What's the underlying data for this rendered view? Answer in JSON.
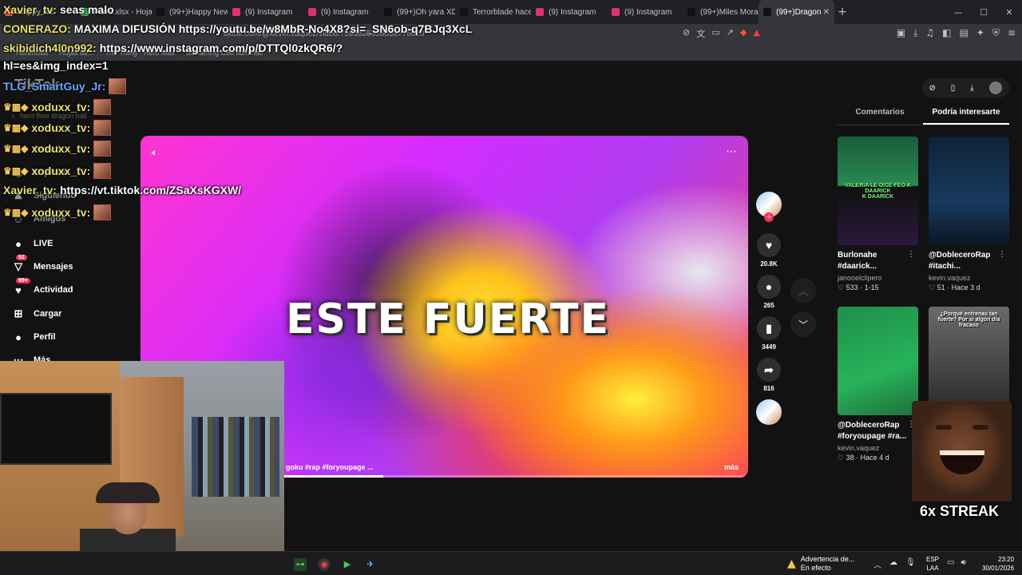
{
  "browser": {
    "tabs": [
      {
        "label": "Happy Ric",
        "color": "#ff4b4b"
      },
      {
        "label": "Perre.xlsx - Hojas",
        "color": "#34a853"
      },
      {
        "label": "(99+)Happy New",
        "color": "#111111"
      },
      {
        "label": "(9) Instagram",
        "color": "#e1306c"
      },
      {
        "label": "(9) Instagram",
        "color": "#e1306c"
      },
      {
        "label": "(99+)Oh yara XD",
        "color": "#111111"
      },
      {
        "label": "Terrorblade hace",
        "color": "#111111"
      },
      {
        "label": "(9) Instagram",
        "color": "#e1306c"
      },
      {
        "label": "(9) Instagram",
        "color": "#e1306c"
      },
      {
        "label": "(99+)Miles Moral",
        "color": "#111111"
      },
      {
        "label": "(99+)Dragon",
        "color": "#111111",
        "active": true
      }
    ],
    "new_tab": "+",
    "url": "tiktok.com/@kevin.vaquez/video/7593825358038776620",
    "bookmarks": [
      "Herencias",
      "Hojas de...",
      "The Thing - Hero Max",
      "Streaming Ceo Iluminati"
    ],
    "window_controls": [
      "—",
      "☐",
      "✕"
    ]
  },
  "sidebar": {
    "logo": "TikTok",
    "search_placeholder": "hero flow dragon ball",
    "items": [
      {
        "label": "Para ti",
        "icon": "⌂"
      },
      {
        "label": "Explorar",
        "icon": "◎"
      },
      {
        "label": "Siguiendo",
        "icon": "♟"
      },
      {
        "label": "Amigos",
        "icon": "☺"
      },
      {
        "label": "LIVE",
        "icon": "●"
      },
      {
        "label": "Mensajes",
        "icon": "▽",
        "badge": "92"
      },
      {
        "label": "Actividad",
        "icon": "♥",
        "badge": "99+"
      },
      {
        "label": "Cargar",
        "icon": "⊞"
      },
      {
        "label": "Perfil",
        "icon": "●"
      },
      {
        "label": "Más",
        "icon": "⋯"
      }
    ]
  },
  "video": {
    "caption": "ESTE FUERTE",
    "description": "goku #rap #foryoupage ...",
    "more_link": "más",
    "progress": 0.4
  },
  "actions": {
    "likes": "20.8K",
    "comments": "265",
    "saves": "3449",
    "shares": "816"
  },
  "panel": {
    "tabs": [
      "Comentarios",
      "Podría interesarte"
    ],
    "active_tab": 1,
    "cards": [
      {
        "title1": "Burlonahe",
        "title2": "#daarick...",
        "user": "janooelclipero",
        "likes": "533",
        "time": "1-15",
        "thumb_text": "VALERIA LE DICE FEO A DAARICK\nK DAARICK"
      },
      {
        "title1": "@DobleceroRap",
        "title2": "#itachi...",
        "user": "kevin.vaquez",
        "likes": "51",
        "time": "Hace 3 d",
        "thumb_text": ""
      },
      {
        "title1": "@DobleceroRap",
        "title2": "#foryoupage #ra...",
        "user": "kevin.vaquez",
        "likes": "38",
        "time": "Hace 4 d",
        "thumb_text": ""
      },
      {
        "title1": "",
        "title2": "",
        "user": "",
        "likes": "",
        "time": "",
        "thumb_text": "¿Porqué entrenas tan fuerte? Por si algún día fracaso"
      }
    ]
  },
  "chat": [
    {
      "name": "Xavier_tv",
      "text": "seas malo",
      "style": "yellow"
    },
    {
      "name": "CONERAZO",
      "text": "MAXIMA DIFUSIÓN https://youtu.be/w8MbR-No4X8?si=_SN6ob-q7BJq3XcL",
      "style": "yellow"
    },
    {
      "name": "skibidich4l0n992",
      "text": "https://www.instagram.com/p/DTTQl0zkQR6/?",
      "style": "yellow"
    },
    {
      "name": "",
      "text": "hl=es&img_index=1",
      "style": "white"
    },
    {
      "name": "TLG_SmartGuy_Jr:",
      "text": "",
      "style": "blue"
    },
    {
      "name": "xoduxx_tv:",
      "text": "",
      "style": "yellow"
    },
    {
      "name": "xoduxx_tv:",
      "text": "",
      "style": "yellow"
    },
    {
      "name": "xoduxx_tv:",
      "text": "",
      "style": "yellow"
    },
    {
      "name": "xoduxx_tv:",
      "text": "",
      "style": "yellow"
    },
    {
      "name": "Xavier_tv",
      "text": "https://vt.tiktok.com/ZSaXsKGXW/",
      "style": "yellow"
    },
    {
      "name": "xoduxx_tv:",
      "text": "",
      "style": "yellow"
    }
  ],
  "streak": "6x STREAK",
  "taskbar": {
    "warning_title": "Advertencia de...",
    "warning_sub": "En efecto",
    "lang1": "ESP",
    "lang2": "LAA",
    "time": "23:20",
    "date": "30/01/2026"
  }
}
